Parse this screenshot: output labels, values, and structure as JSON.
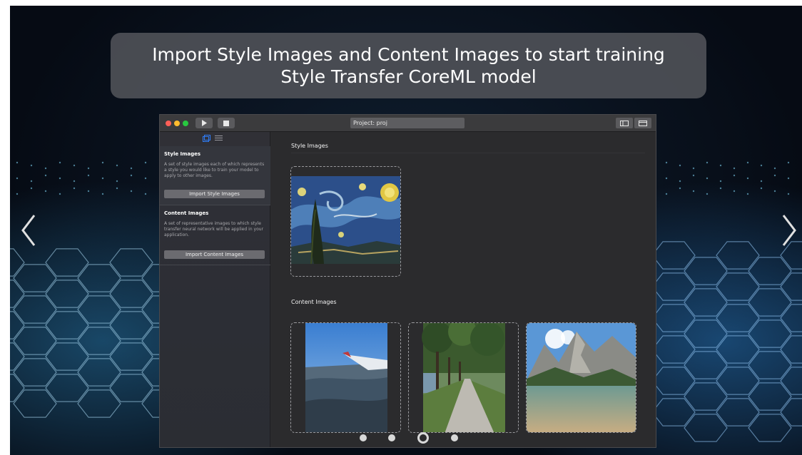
{
  "banner": {
    "line1": "Import Style Images and Content Images to start training",
    "line2": "Style Transfer CoreML model"
  },
  "carousel": {
    "prev_icon": "chevron-left-icon",
    "next_icon": "chevron-right-icon",
    "dots": 4,
    "active_dot": 3
  },
  "window": {
    "project_field": "Project: proj",
    "toolbar_icons": [
      "play-icon",
      "stop-icon",
      "layout-split-icon",
      "layout-single-icon"
    ]
  },
  "sidebar": {
    "tab_icons": [
      "images-icon",
      "list-icon"
    ],
    "style_section": {
      "title": "Style Images",
      "description": "A set of style images each of which represents a style you would like to train your model to apply to other images.",
      "button": "Import Style Images"
    },
    "content_section": {
      "title": "Content Images",
      "description": "A set of representative images to which style transfer neural network will be applied in your application.",
      "button": "Import Content Images"
    }
  },
  "main": {
    "style_title": "Style Images",
    "content_title": "Content Images"
  },
  "colors": {
    "accent": "#2f7cf6",
    "window_bg": "#2b2b2d",
    "banner_bg": "#4e5056"
  }
}
